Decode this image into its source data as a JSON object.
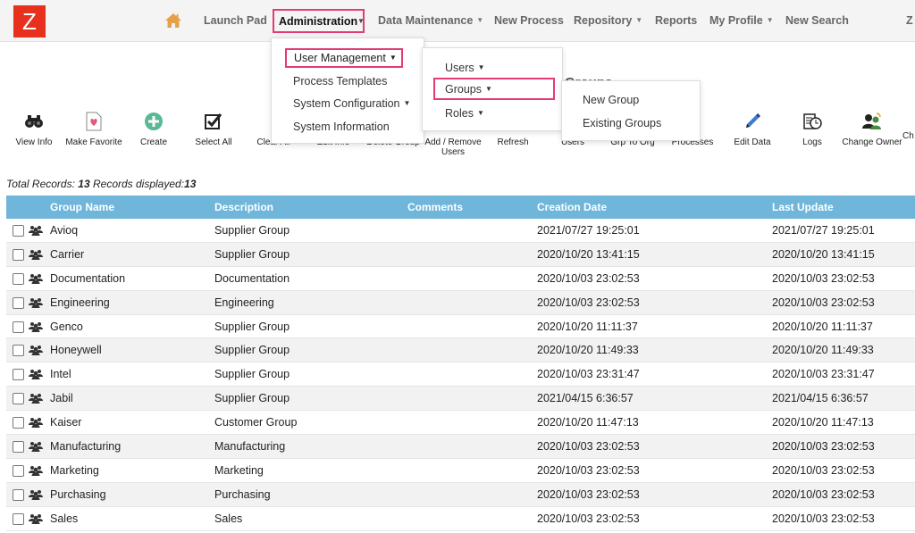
{
  "logo": {
    "letter": "Z",
    "color": "#e8301e"
  },
  "nav": {
    "home_icon": "home-icon",
    "items": [
      {
        "label": "Launch Pad",
        "caret": false
      },
      {
        "label": "Administration",
        "caret": true
      },
      {
        "label": "Data Maintenance",
        "caret": true
      },
      {
        "label": "New Process",
        "caret": false
      },
      {
        "label": "Repository",
        "caret": true
      },
      {
        "label": "Reports",
        "caret": false
      },
      {
        "label": "My Profile",
        "caret": true
      },
      {
        "label": "New Search",
        "caret": false
      },
      {
        "label": "Z",
        "caret": false
      }
    ],
    "highlight_color": "#e63a78"
  },
  "menu_admin": {
    "items": [
      "User Management",
      "Process Templates",
      "System Configuration",
      "System Information"
    ]
  },
  "menu_user_mgmt": {
    "items": [
      "Users",
      "Groups",
      "Roles"
    ]
  },
  "menu_groups": {
    "items": [
      "New Group",
      "Existing Groups"
    ]
  },
  "background_heading": "Groups",
  "toolbar": [
    {
      "label": "View Info",
      "icon": "binoculars-icon"
    },
    {
      "label": "Make Favorite",
      "icon": "favorite-doc-icon"
    },
    {
      "label": "Create",
      "icon": "plus-circle-icon"
    },
    {
      "label": "Select All",
      "icon": "checkbox-icon"
    },
    {
      "label": "Clear All",
      "icon": "clear-icon"
    },
    {
      "label": "Edit Info",
      "icon": "edit-info-icon"
    },
    {
      "label": "Delete Group",
      "icon": "delete-icon"
    },
    {
      "label": "Add / Remove Users",
      "icon": "add-remove-users-icon"
    },
    {
      "label": "Refresh",
      "icon": "refresh-icon"
    },
    {
      "label": "Users",
      "icon": "users-icon"
    },
    {
      "label": "Grp To Org",
      "icon": "grp-to-org-icon"
    },
    {
      "label": "Processes",
      "icon": "processes-icon"
    },
    {
      "label": "Edit Data",
      "icon": "pencil-icon"
    },
    {
      "label": "Logs",
      "icon": "logs-icon"
    },
    {
      "label": "Change Owner",
      "icon": "change-owner-icon"
    },
    {
      "label": "Ch",
      "icon": ""
    }
  ],
  "records": {
    "total_label": "Total Records:",
    "total": "13",
    "displayed_label": "Records displayed:",
    "displayed": "13"
  },
  "table": {
    "header_color": "#6fb6da",
    "columns": [
      "Group Name",
      "Description",
      "Comments",
      "Creation Date",
      "Last Update"
    ],
    "rows": [
      {
        "name": "Avioq",
        "desc": "Supplier Group",
        "comments": "",
        "created": "2021/07/27 19:25:01",
        "updated": "2021/07/27 19:25:01"
      },
      {
        "name": "Carrier",
        "desc": "Supplier Group",
        "comments": "",
        "created": "2020/10/20 13:41:15",
        "updated": "2020/10/20 13:41:15"
      },
      {
        "name": "Documentation",
        "desc": "Documentation",
        "comments": "",
        "created": "2020/10/03 23:02:53",
        "updated": "2020/10/03 23:02:53"
      },
      {
        "name": "Engineering",
        "desc": "Engineering",
        "comments": "",
        "created": "2020/10/03 23:02:53",
        "updated": "2020/10/03 23:02:53"
      },
      {
        "name": "Genco",
        "desc": "Supplier Group",
        "comments": "",
        "created": "2020/10/20 11:11:37",
        "updated": "2020/10/20 11:11:37"
      },
      {
        "name": "Honeywell",
        "desc": "Supplier Group",
        "comments": "",
        "created": "2020/10/20 11:49:33",
        "updated": "2020/10/20 11:49:33"
      },
      {
        "name": "Intel",
        "desc": "Supplier Group",
        "comments": "",
        "created": "2020/10/03 23:31:47",
        "updated": "2020/10/03 23:31:47"
      },
      {
        "name": "Jabil",
        "desc": "Supplier Group",
        "comments": "",
        "created": "2021/04/15 6:36:57",
        "updated": "2021/04/15 6:36:57"
      },
      {
        "name": "Kaiser",
        "desc": "Customer Group",
        "comments": "",
        "created": "2020/10/20 11:47:13",
        "updated": "2020/10/20 11:47:13"
      },
      {
        "name": "Manufacturing",
        "desc": "Manufacturing",
        "comments": "",
        "created": "2020/10/03 23:02:53",
        "updated": "2020/10/03 23:02:53"
      },
      {
        "name": "Marketing",
        "desc": "Marketing",
        "comments": "",
        "created": "2020/10/03 23:02:53",
        "updated": "2020/10/03 23:02:53"
      },
      {
        "name": "Purchasing",
        "desc": "Purchasing",
        "comments": "",
        "created": "2020/10/03 23:02:53",
        "updated": "2020/10/03 23:02:53"
      },
      {
        "name": "Sales",
        "desc": "Sales",
        "comments": "",
        "created": "2020/10/03 23:02:53",
        "updated": "2020/10/03 23:02:53"
      }
    ]
  }
}
